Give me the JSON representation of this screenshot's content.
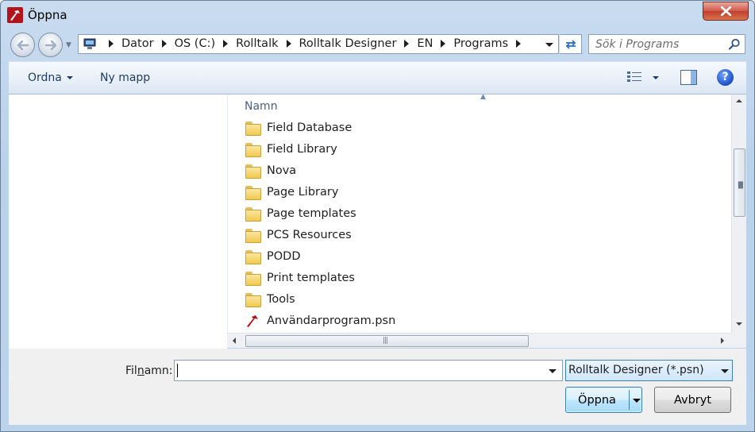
{
  "window": {
    "title": "Öppna",
    "close_label": "Stäng"
  },
  "address": {
    "crumbs": [
      "Dator",
      "OS (C:)",
      "Rolltalk",
      "Rolltalk Designer",
      "EN",
      "Programs"
    ]
  },
  "search": {
    "placeholder": "Sök i Programs"
  },
  "toolbar": {
    "organize": "Ordna",
    "new_folder": "Ny mapp",
    "help": "?"
  },
  "files": {
    "column": "Namn",
    "items": [
      {
        "name": "Field Database",
        "icon": "folder-icon"
      },
      {
        "name": "Field Library",
        "icon": "folder-icon"
      },
      {
        "name": "Nova",
        "icon": "folder-icon"
      },
      {
        "name": "Page Library",
        "icon": "folder-icon"
      },
      {
        "name": "Page templates",
        "icon": "folder-icon"
      },
      {
        "name": "PCS Resources",
        "icon": "folder-icon"
      },
      {
        "name": "PODD",
        "icon": "folder-icon"
      },
      {
        "name": "Print templates",
        "icon": "folder-icon"
      },
      {
        "name": "Tools",
        "icon": "folder-icon"
      },
      {
        "name": "Användarprogram.psn",
        "icon": "rolltalk-file-icon"
      }
    ]
  },
  "bottom": {
    "filename_label_pre": "Fil",
    "filename_label_u": "n",
    "filename_label_post": "amn:",
    "filename_value": "",
    "filetype": "Rolltalk Designer (*.psn)",
    "open": "Öppna",
    "cancel": "Avbryt"
  },
  "colors": {
    "accent": "#3c7fb1",
    "titlebar": "#c9dcf0",
    "close": "#c13e2d"
  }
}
